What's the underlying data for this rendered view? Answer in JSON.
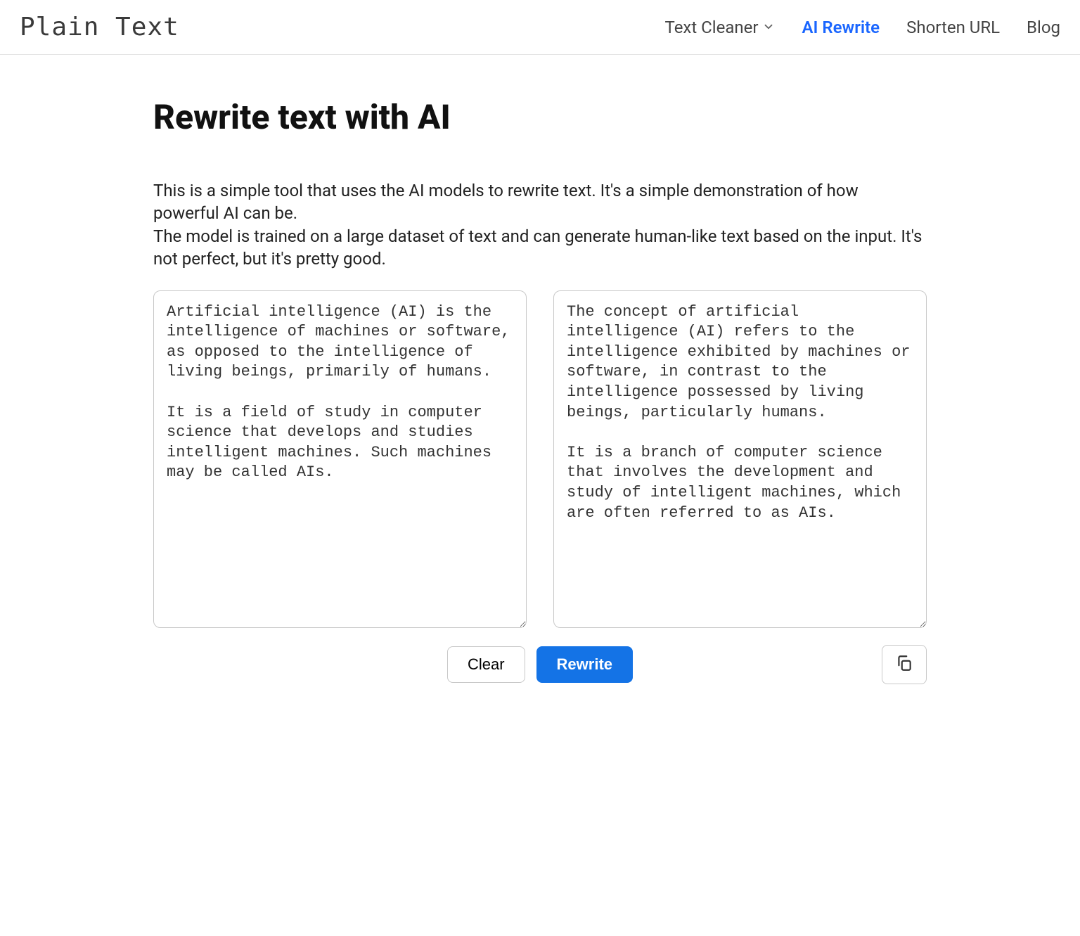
{
  "header": {
    "logo": "Plain Text",
    "nav": {
      "text_cleaner": "Text Cleaner",
      "ai_rewrite": "AI Rewrite",
      "shorten_url": "Shorten URL",
      "blog": "Blog"
    }
  },
  "main": {
    "title": "Rewrite text with AI",
    "description_line1": "This is a simple tool that uses the AI models to rewrite text. It's a simple demonstration of how powerful AI can be.",
    "description_line2": "The model is trained on a large dataset of text and can generate human-like text based on the input. It's not perfect, but it's pretty good.",
    "input_text": "Artificial intelligence (AI) is the intelligence of machines or software, as opposed to the intelligence of living beings, primarily of humans.\n\nIt is a field of study in computer science that develops and studies intelligent machines. Such machines may be called AIs.",
    "output_text": "The concept of artificial intelligence (AI) refers to the intelligence exhibited by machines or software, in contrast to the intelligence possessed by living beings, particularly humans.\n\nIt is a branch of computer science that involves the development and study of intelligent machines, which are often referred to as AIs.",
    "buttons": {
      "clear": "Clear",
      "rewrite": "Rewrite"
    }
  }
}
